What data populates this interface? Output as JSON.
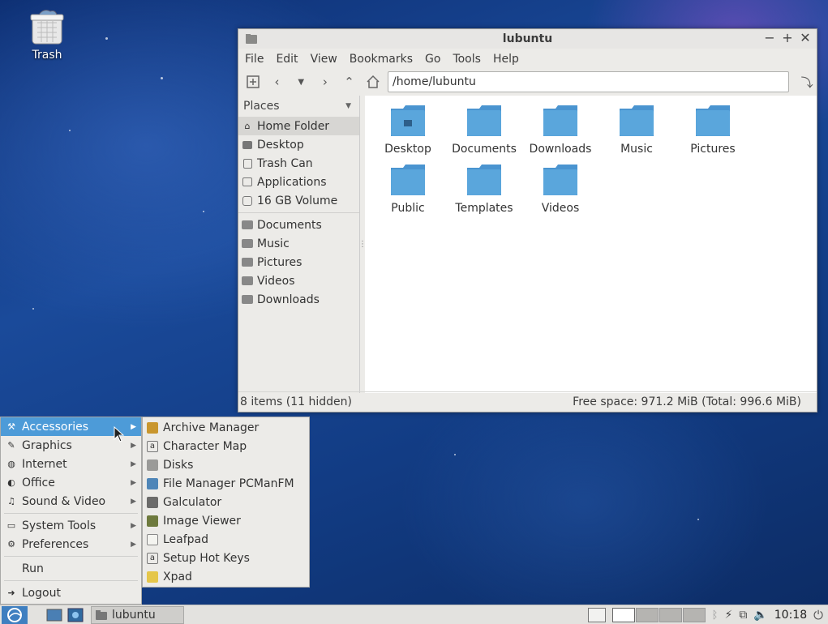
{
  "desktop": {
    "trash_label": "Trash"
  },
  "window": {
    "title": "lubuntu",
    "controls": {
      "minimize": "−",
      "maximize": "+",
      "close": "✕"
    },
    "menu": [
      "File",
      "Edit",
      "View",
      "Bookmarks",
      "Go",
      "Tools",
      "Help"
    ],
    "path": "/home/lubuntu",
    "places_header": "Places",
    "places": [
      "Home Folder",
      "Desktop",
      "Trash Can",
      "Applications",
      "16 GB Volume"
    ],
    "bookmarks": [
      "Documents",
      "Music",
      "Pictures",
      "Videos",
      "Downloads"
    ],
    "files": [
      "Desktop",
      "Documents",
      "Downloads",
      "Music",
      "Pictures",
      "Public",
      "Templates",
      "Videos"
    ],
    "status_left": "8 items (11 hidden)",
    "status_right": "Free space: 971.2 MiB (Total: 996.6 MiB)"
  },
  "start_menu": {
    "items": [
      "Accessories",
      "Graphics",
      "Internet",
      "Office",
      "Sound & Video"
    ],
    "items2": [
      "System Tools",
      "Preferences"
    ],
    "run": "Run",
    "logout": "Logout"
  },
  "accessories": [
    "Archive Manager",
    "Character Map",
    "Disks",
    "File Manager PCManFM",
    "Galculator",
    "Image Viewer",
    "Leafpad",
    "Setup Hot Keys",
    "Xpad"
  ],
  "taskbar": {
    "task_label": "lubuntu",
    "clock": "10:18"
  },
  "colors": {
    "highlight": "#4d9bd8",
    "folder": "#5aa6dc"
  }
}
